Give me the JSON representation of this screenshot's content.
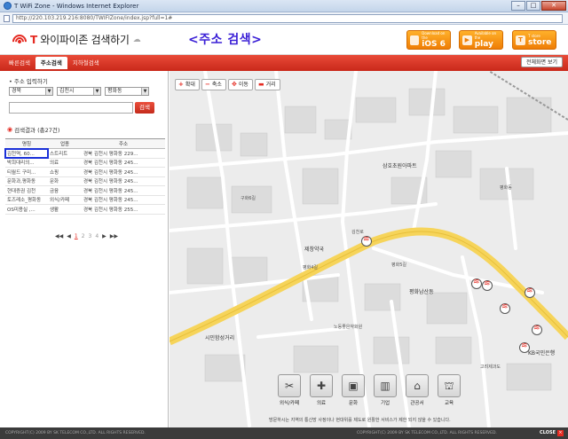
{
  "window": {
    "title": "T WiFi Zone - Windows Internet Explorer",
    "url": "http://220.103.219.216:8080/TWIFIZone/index.jsp?full=1#",
    "minimize": "–",
    "maximize": "□",
    "close": "✕"
  },
  "header": {
    "logo_t": "T",
    "logo_text": " 와이파이존 검색하기",
    "page_heading": "<주소 검색>",
    "stores": [
      {
        "small": "Download on the",
        "label": "iOS",
        "badge": "6",
        "icon": "apple-icon"
      },
      {
        "small": "Available on the",
        "label": "play",
        "icon": "android-icon"
      },
      {
        "small": "T store",
        "label": "store",
        "icon": "tstore-icon"
      }
    ]
  },
  "tabs": [
    {
      "label": "빠른검색",
      "active": false
    },
    {
      "label": "주소검색",
      "active": true
    },
    {
      "label": "지하철검색",
      "active": false
    }
  ],
  "fullscreen_label": "전체화면 보기",
  "search": {
    "address_label": "주소 입력하기",
    "province": "경북",
    "city": "김천시",
    "district": "평화동",
    "input_value": "",
    "button_label": "검색"
  },
  "results": {
    "title": "검색결과 (총27건)",
    "columns": [
      "명칭",
      "업종",
      "주소"
    ],
    "rows": [
      [
        "김천역, 60...",
        "스트리트",
        "경북 김천시 평화동 229..."
      ],
      [
        "박희대리의...",
        "의료",
        "경북 김천시 평화동 245..."
      ],
      [
        "티월드 구미...",
        "쇼핑",
        "경북 김천시 평화동 245..."
      ],
      [
        "문화과,평화동",
        "문화",
        "경북 김천시 평화동 245..."
      ],
      [
        "현대증권 김천",
        "금융",
        "경북 김천시 평화동 245..."
      ],
      [
        "토즈레소_평화동",
        "외식/카페",
        "경북 김천시 평화동 245..."
      ],
      [
        "OS미용실 ,...",
        "생활",
        "경북 김천시 평화동 255..."
      ]
    ],
    "pager": {
      "first": "◀◀",
      "prev": "◀",
      "current": "1",
      "pages": [
        "2",
        "3",
        "4"
      ],
      "next": "▶",
      "last": "▶▶"
    }
  },
  "map_controls": [
    {
      "icon": "+",
      "label": "확대"
    },
    {
      "icon": "−",
      "label": "축소"
    },
    {
      "icon": "✥",
      "label": "이동"
    },
    {
      "icon": "▬",
      "label": "거리"
    }
  ],
  "map_labels": [
    {
      "text": "삼호초원아파트",
      "cls": "big"
    },
    {
      "text": "평화동",
      "cls": ""
    },
    {
      "text": "제창약국",
      "cls": "big"
    },
    {
      "text": "김천로",
      "cls": ""
    },
    {
      "text": "평화남산동",
      "cls": "big"
    },
    {
      "text": "노동좋은약화원",
      "cls": ""
    },
    {
      "text": "시민함성거리",
      "cls": "big"
    },
    {
      "text": "KB국민은행",
      "cls": "big"
    },
    {
      "text": "고려제과도",
      "cls": ""
    },
    {
      "text": "평화4길",
      "cls": ""
    },
    {
      "text": "평화5길",
      "cls": ""
    },
    {
      "text": "구화6길",
      "cls": ""
    }
  ],
  "categories": [
    {
      "label": "외식/카페",
      "icon": "✂"
    },
    {
      "label": "의료",
      "icon": "✚"
    },
    {
      "label": "문화",
      "icon": "▣"
    },
    {
      "label": "기업",
      "icon": "▥"
    },
    {
      "label": "관공서",
      "icon": "⌂"
    },
    {
      "label": "교육",
      "icon": "⛫"
    }
  ],
  "map_notice": "방문하시는 지역의 통신망 사정이나 현대위를 제도로 원활한 서비스가 제한 되지 않을 수 있습니다.",
  "footer": {
    "left": "COPYRIGHT(C) 2009 BY SK TELECOM CO.,LTD. ALL RIGHTS RESERVED.",
    "right": "COPYRIGHT(C) 2009 BY SK TELECOM CO.,LTD. ALL RIGHTS RESERVED.",
    "close_label": "CLOSE"
  },
  "colors": {
    "accent": "#e52b22",
    "heading": "#3a1fd6",
    "store": "#ef7d05",
    "select_box": "#1a30d8"
  }
}
